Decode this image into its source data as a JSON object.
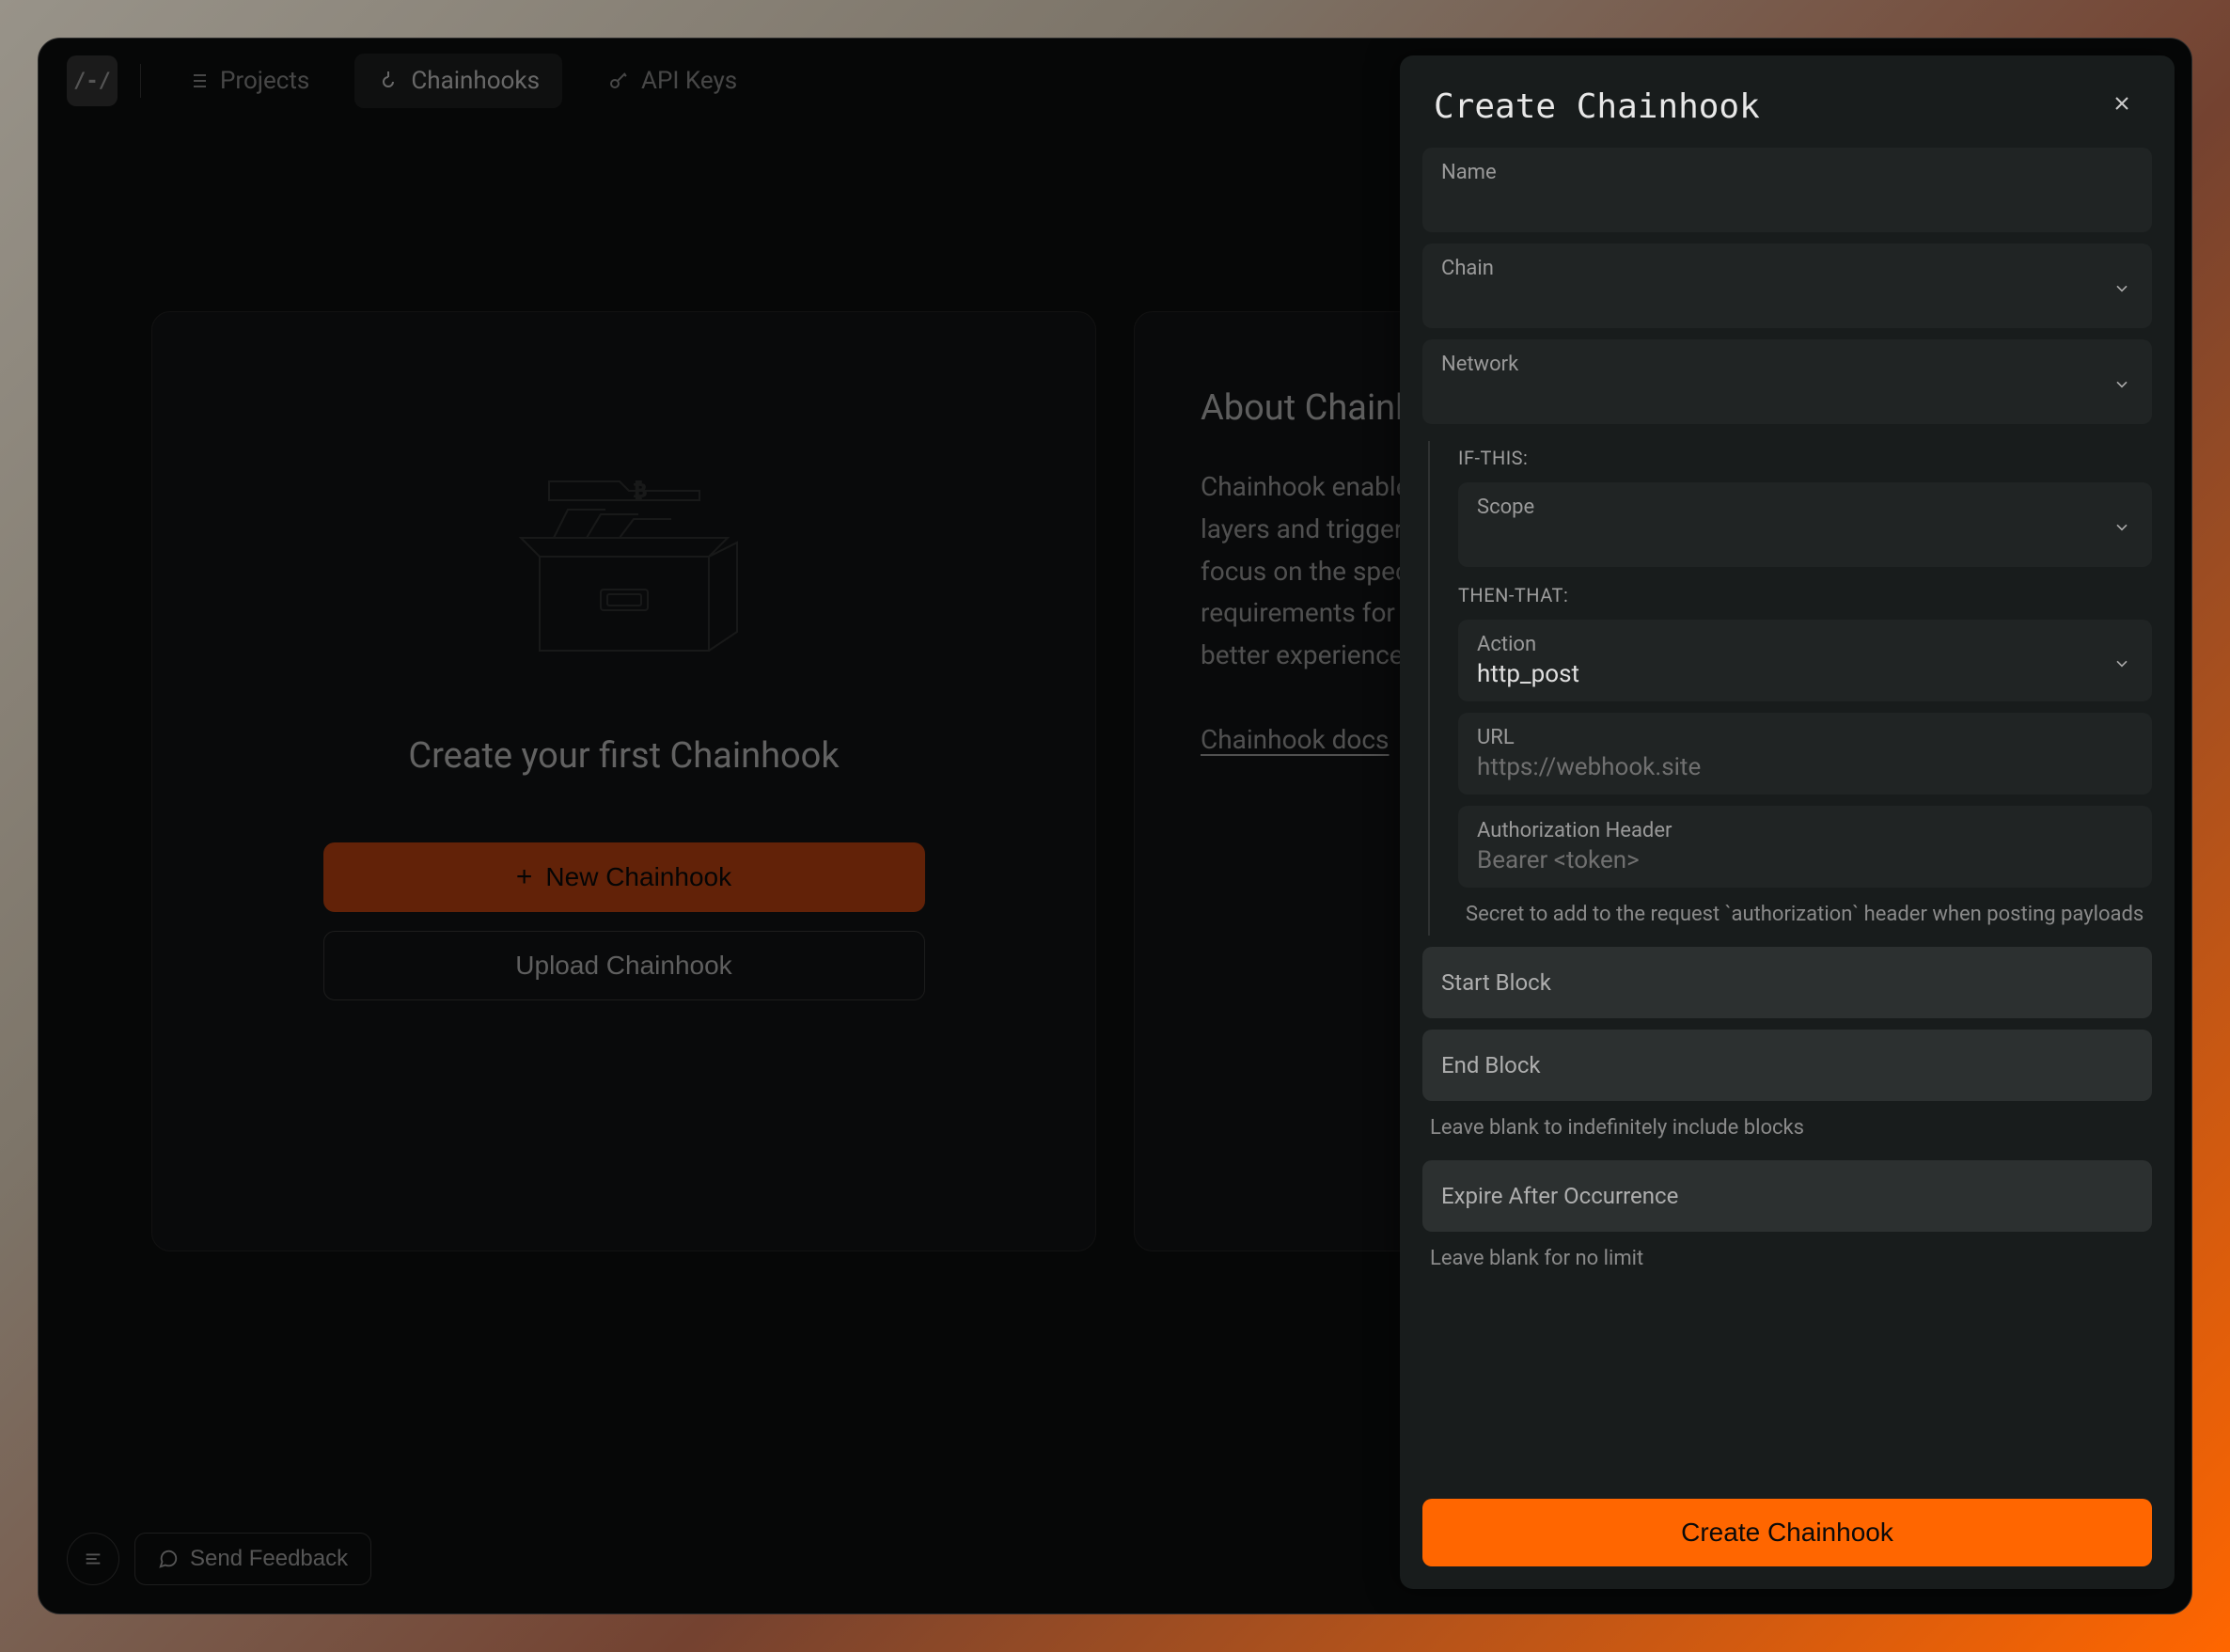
{
  "nav": {
    "logo": "/-/",
    "items": [
      {
        "label": "Projects"
      },
      {
        "label": "Chainhooks"
      },
      {
        "label": "API Keys"
      }
    ]
  },
  "empty_state": {
    "title": "Create your first Chainhook",
    "new_btn": "New Chainhook",
    "upload_btn": "Upload Chainhook"
  },
  "about": {
    "title": "About Chainhooks",
    "text": "Chainhook enables you to build custom event streams for Bitcoin layers and trigger actions based on those events. Chainhooks let you focus on the specific data you need, which means lighter storage requirements for databases, giving you an easier path to build lighter, better experiences for your users.",
    "docs_link": "Chainhook docs"
  },
  "bottom": {
    "feedback": "Send Feedback"
  },
  "panel": {
    "title": "Create Chainhook",
    "fields": {
      "name_label": "Name",
      "chain_label": "Chain",
      "network_label": "Network",
      "if_this_label": "IF-THIS:",
      "scope_label": "Scope",
      "then_that_label": "THEN-THAT:",
      "action_label": "Action",
      "action_value": "http_post",
      "url_label": "URL",
      "url_placeholder": "https://webhook.site",
      "auth_label": "Authorization Header",
      "auth_placeholder": "Bearer <token>",
      "auth_helper": "Secret to add to the request `authorization` header when posting payloads",
      "start_block_label": "Start Block",
      "end_block_label": "End Block",
      "end_block_helper": "Leave blank to indefinitely include blocks",
      "expire_label": "Expire After Occurrence",
      "expire_helper": "Leave blank for no limit"
    },
    "submit": "Create Chainhook"
  }
}
